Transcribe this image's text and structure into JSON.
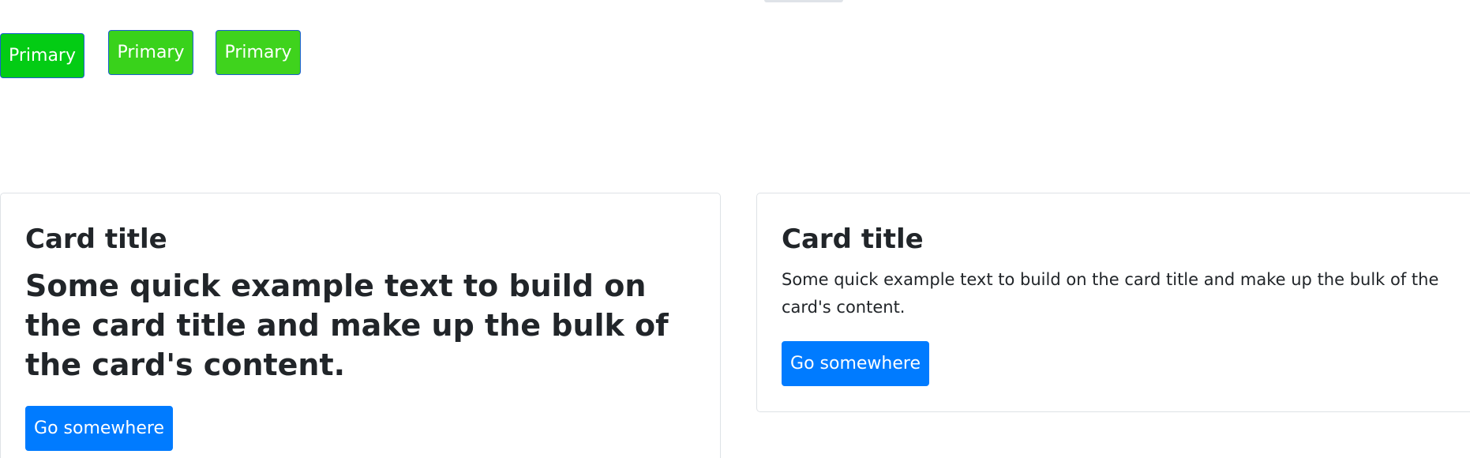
{
  "buttons": {
    "primary_1": "Primary",
    "primary_2": "Primary",
    "primary_3": "Primary"
  },
  "cards": [
    {
      "title": "Card title",
      "text": "Some quick example text to build on the card title and make up the bulk of the card's content.",
      "button": "Go somewhere"
    },
    {
      "title": "Card title",
      "text": "Some quick example text to build on the card title and make up the bulk of the card's content.",
      "button": "Go somewhere"
    }
  ],
  "colors": {
    "green_1": "#03cc14",
    "green_2": "#39d21b",
    "green_3": "#3fd31d",
    "blue_button": "#007bff",
    "text": "#212529",
    "card_border": "#dee2e6"
  }
}
